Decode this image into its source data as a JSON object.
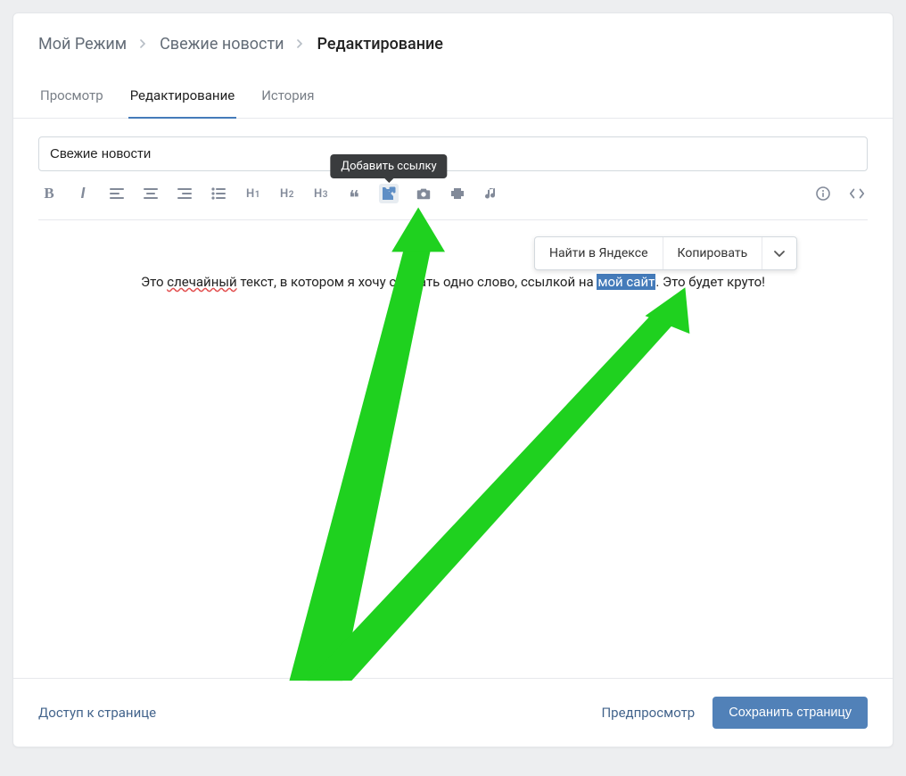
{
  "breadcrumb": {
    "item1": "Мой Режим",
    "item2": "Свежие новости",
    "item3": "Редактирование"
  },
  "tabs": {
    "view": "Просмотр",
    "edit": "Редактирование",
    "history": "История"
  },
  "title_input_value": "Свежие новости",
  "tooltip_link": "Добавить ссылку",
  "content": {
    "part1": "Это ",
    "misspell": "слечайный",
    "part2": " текст, в котором я хочу сделать одно слово, ссылкой на ",
    "selected": "мой сайт",
    "part3": ". Это будет круто!"
  },
  "context_menu": {
    "search": "Найти в Яндексе",
    "copy": "Копировать"
  },
  "footer": {
    "access": "Доступ к странице",
    "preview": "Предпросмотр",
    "save": "Сохранить страницу"
  },
  "icons": {
    "bold": "B",
    "italic": "I",
    "h1": "H",
    "h1s": "1",
    "h2": "H",
    "h2s": "2",
    "h3": "H",
    "h3s": "3",
    "quote": "❝"
  },
  "colors": {
    "accent": "#447bba",
    "arrow": "#1fd11f"
  }
}
